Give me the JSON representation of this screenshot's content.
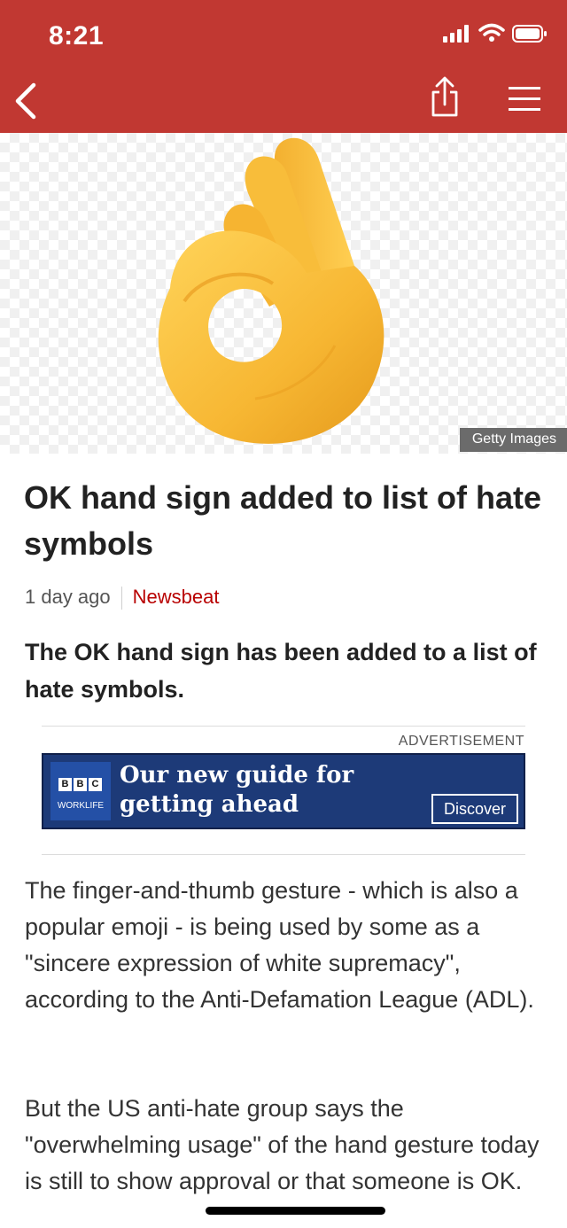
{
  "status_bar": {
    "time": "8:21"
  },
  "colors": {
    "brand": "#c13832",
    "source": "#b80000",
    "ad_background": "#1d3a78"
  },
  "nav": {
    "back_icon": "chevron-left-icon",
    "share_icon": "share-icon",
    "menu_icon": "hamburger-menu-icon"
  },
  "hero": {
    "image": "ok-hand-emoji",
    "credit": "Getty Images"
  },
  "article": {
    "headline": "OK hand sign added to list of hate symbols",
    "time": "1 day ago",
    "source": "Newsbeat",
    "summary": "The OK hand sign has been added to a list of hate symbols.",
    "paragraphs": [
      "The finger-and-thumb gesture - which is also a popular emoji - is being used by some as a \"sincere expression of white supremacy\", according to the Anti-Defamation League (ADL).",
      "But the US anti-hate group says the \"overwhelming usage\" of the hand gesture today is still to show approval or that someone is OK."
    ]
  },
  "ad": {
    "label": "ADVERTISEMENT",
    "logo_letters": [
      "B",
      "B",
      "C"
    ],
    "logo_sub": "WORKLIFE",
    "headline": "Our new guide for getting ahead",
    "button": "Discover"
  }
}
